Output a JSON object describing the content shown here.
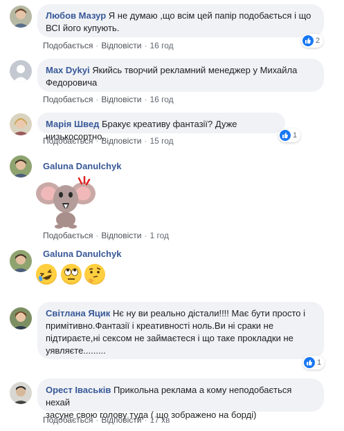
{
  "colors": {
    "author": "#385898",
    "bubble": "#f0f2f5",
    "like": "#1877f2"
  },
  "comments": [
    {
      "author": "Любов Мазур",
      "line1": "Я не думаю ,що всім цей папір подобається і що",
      "line2": "ВСІ його купують.",
      "like": "Подобається",
      "reply": "Відповісти",
      "time": "16 год",
      "reaction_count": "2"
    },
    {
      "author": "Max Dykyi",
      "line1": "Якийсь творчий рекламний менеджер у Михайла",
      "line2": "Федоровича",
      "like": "Подобається",
      "reply": "Відповісти",
      "time": "16 год"
    },
    {
      "author": "Марія Швед",
      "line1": "Бракує креативу фантазії? Дуже низькосортно.",
      "like": "Подобається",
      "reply": "Відповісти",
      "time": "15 год",
      "reaction_count": "1"
    },
    {
      "author": "Galuna Danulchyk",
      "sticker": "elephant-sticker",
      "like": "Подобається",
      "reply": "Відповісти",
      "time": "1 год"
    },
    {
      "author": "Galuna Danulchyk",
      "emojis": [
        "laughing-emoji",
        "eye-roll-emoji",
        "thinking-emoji"
      ],
      "like": "Подобається",
      "reply": "Відповісти",
      "time": "1 год"
    },
    {
      "author": "Світлана Яцик",
      "line1": "Нє ну ви реально дістали!!!! Має бути просто і",
      "line2": "примітивно.Фантазії і креативності ноль.Ви ні сраки не",
      "line3": "підтираєте,ні сексом не займаєтеся і що таке прокладки не",
      "line4": "уявляєте.........",
      "reaction_count": "1"
    },
    {
      "author": "Орест Іваськів",
      "line1": "Прикольна реклама а кому неподобається нехай",
      "line2": "засуне свою голову туда ( що зображено на борді)",
      "like": "Подобається",
      "reply": "Відповісти",
      "time": "17 хв"
    }
  ]
}
